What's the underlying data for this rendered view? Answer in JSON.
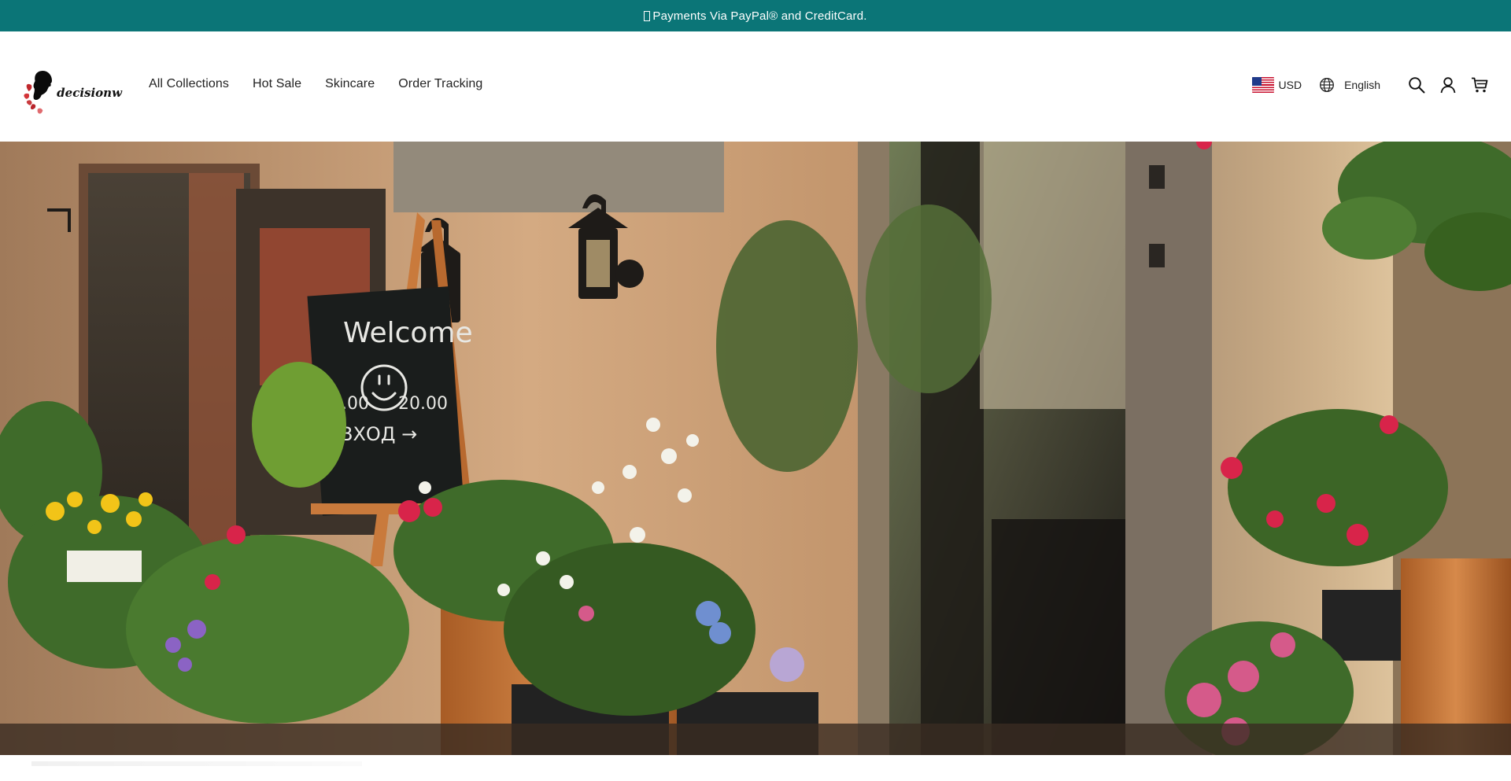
{
  "announcement": {
    "text": "Payments Via PayPal® and CreditCard.",
    "background": "#0b7577"
  },
  "header": {
    "logo_text": "decisionw",
    "nav": [
      {
        "label": "All Collections"
      },
      {
        "label": "Hot Sale"
      },
      {
        "label": "Skincare"
      },
      {
        "label": "Order Tracking"
      }
    ],
    "currency": {
      "label": "USD",
      "flag_icon": "us-flag-icon"
    },
    "language": {
      "label": "English",
      "icon": "globe-icon"
    },
    "icons": [
      "search-icon",
      "account-icon",
      "cart-icon"
    ]
  },
  "hero": {
    "chalkboard": {
      "line1": "Welcome",
      "open_time": "8.00",
      "close_time": "20.00",
      "entry": "ВХОД →"
    },
    "colors": {
      "wall": "#c79a73",
      "wood": "#c57a3a",
      "door_glass": "#3b3a30",
      "foliage": "#3f6b2a"
    }
  }
}
